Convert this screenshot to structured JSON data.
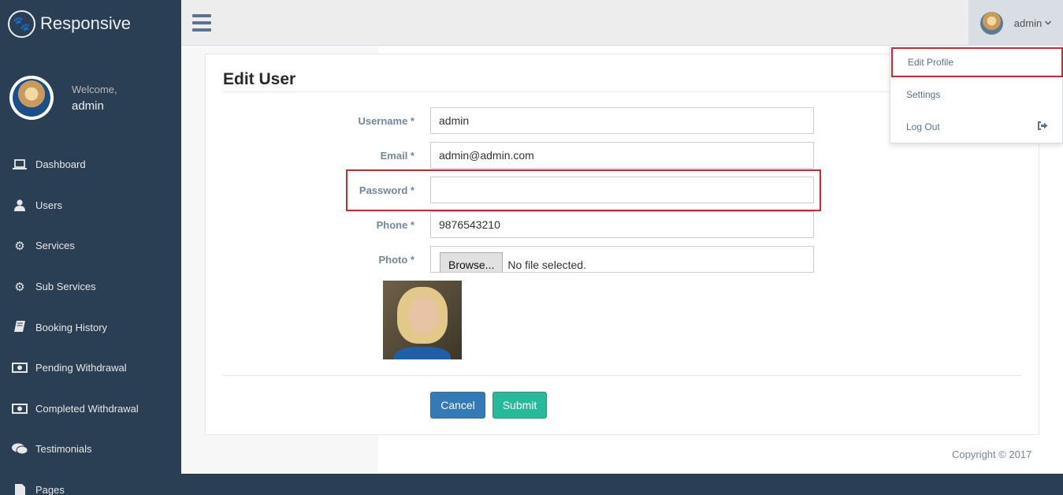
{
  "app": {
    "brand": "Responsive"
  },
  "sidebar": {
    "welcome": "Welcome,",
    "username": "admin",
    "items": [
      {
        "label": "Dashboard",
        "icon": "laptop-icon"
      },
      {
        "label": "Users",
        "icon": "user-icon"
      },
      {
        "label": "Services",
        "icon": "gear-icon"
      },
      {
        "label": "Sub Services",
        "icon": "gear-icon"
      },
      {
        "label": "Booking History",
        "icon": "book-icon"
      },
      {
        "label": "Pending Withdrawal",
        "icon": "money-icon"
      },
      {
        "label": "Completed Withdrawal",
        "icon": "money-icon"
      },
      {
        "label": "Testimonials",
        "icon": "comments-icon"
      },
      {
        "label": "Pages",
        "icon": "file-icon"
      }
    ]
  },
  "topbar": {
    "user": "admin",
    "dropdown": [
      {
        "label": "Edit Profile"
      },
      {
        "label": "Settings"
      },
      {
        "label": "Log Out"
      }
    ]
  },
  "form": {
    "title": "Edit User",
    "fields": {
      "username": {
        "label": "Username *",
        "value": "admin"
      },
      "email": {
        "label": "Email *",
        "value": "admin@admin.com"
      },
      "password": {
        "label": "Password *",
        "value": ""
      },
      "phone": {
        "label": "Phone *",
        "value": "9876543210"
      },
      "photo": {
        "label": "Photo *",
        "browse": "Browse...",
        "status": "No file selected."
      }
    },
    "cancel": "Cancel",
    "submit": "Submit"
  },
  "footer": {
    "copyright": "Copyright © 2017"
  },
  "colors": {
    "sidebar": "#2a3f54",
    "primary": "#337ab7",
    "success": "#26b99a",
    "highlight": "#d9232e"
  }
}
